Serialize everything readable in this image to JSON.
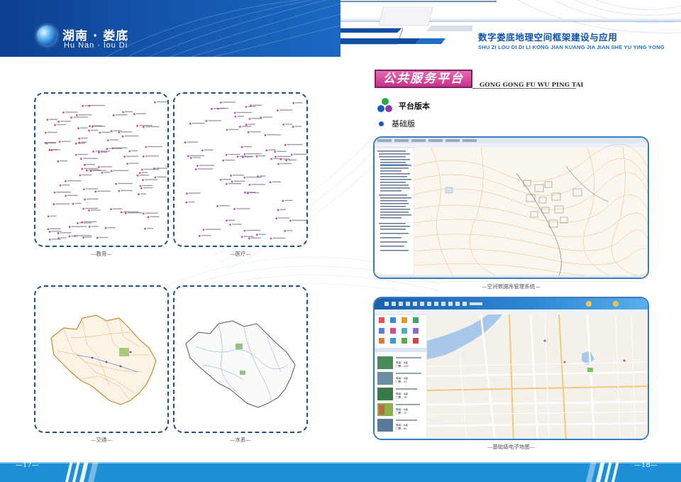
{
  "header": {
    "logo_cn": "湖南 · 娄底",
    "logo_en": "Hu Nan · lou Di",
    "title_cn": "数字娄底地理空间框架建设与应用",
    "title_en": "SHU ZI LOU DI DI LI KONG JIAN KUANG JIA JIAN SHE YU YING YONG"
  },
  "left_page": {
    "captions": {
      "education": "—教育—",
      "medical": "—医疗—",
      "traffic": "—交通—",
      "water": "—水系—"
    },
    "page_number": "—17—"
  },
  "right_page": {
    "section_tag": "公共服务平台",
    "section_tag_en": "GONG GONG FU WU PING TAI",
    "version_label": "平台版本",
    "basic_label": "基础版",
    "screenshot1_caption": "—空间数据库管理系统—",
    "screenshot2_caption": "—基础级电子地图—",
    "page_number": "—18—",
    "screenshot2_items": [
      {
        "labels": [
          "等级：",
          "门票："
        ],
        "values": [
          "A级",
          "200"
        ]
      },
      {
        "labels": [
          "等级：",
          "门票："
        ],
        "values": [
          "A级",
          "53"
        ]
      },
      {
        "labels": [
          "等级：",
          "门票："
        ],
        "values": [
          "A级",
          "78"
        ]
      },
      {
        "labels": [
          "等级：",
          "门票："
        ],
        "values": [
          "A级",
          "72"
        ]
      },
      {
        "labels": [
          "等级：",
          "门票："
        ],
        "values": [
          "A级",
          "64"
        ]
      }
    ]
  },
  "colors": {
    "brand_blue": "#1558b0",
    "accent_pink": "#c7308a",
    "panel_border": "#1c4f8a",
    "footer_blue": "#1e8fd6"
  },
  "icons": [
    "globe-icon",
    "tri-color-dots-icon",
    "bullet-icon"
  ]
}
